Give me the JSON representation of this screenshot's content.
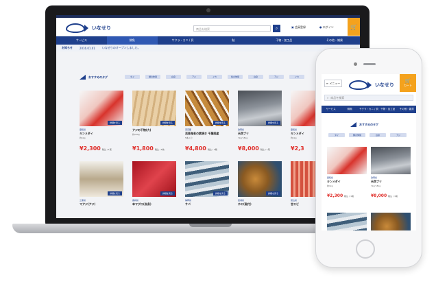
{
  "brand": {
    "logo_text": "いなせり"
  },
  "laptop": {
    "search_placeholder": "商品を検索",
    "links": [
      "会員登録",
      "ログイン"
    ],
    "cart_icon": "cart-icon",
    "nav": [
      "サービス",
      "鮮魚",
      "サクラ・カニ / 貝",
      "鮭",
      "干物・加工品",
      "その他・雑貨"
    ],
    "notice_label": "お知らせ",
    "notice_date": "2016.01.01",
    "notice_text": "いなせりのオープンしました。",
    "section_title": "おすすめのタグ",
    "tags": [
      "タイ",
      "鯛の仲間",
      "白身",
      "アジ",
      "イカ",
      "魚の仲間",
      "白身",
      "アジ",
      "イカ"
    ],
    "products": [
      {
        "area": "愛知県",
        "name": "キンメダイ",
        "sub": "約1kg",
        "price": "¥2,300",
        "unit": "税込 / 1尾",
        "badge": "詳細を見る"
      },
      {
        "area": "",
        "name": "アジの干物(大)",
        "sub": "約500g",
        "price": "¥1,800",
        "unit": "税込 / 1枚",
        "badge": "詳細を見る"
      },
      {
        "area": "東京都",
        "name": "活車海老の素焼き 千葉県産",
        "sub": "5本入り",
        "price": "¥4,800",
        "unit": "税込 / 1箱",
        "badge": "詳細を見る"
      },
      {
        "area": "静岡県",
        "name": "天然ブリ",
        "sub": "7kg〜8kg",
        "price": "¥8,000",
        "unit": "税込 / 1尾",
        "badge": "詳細を見る"
      },
      {
        "area": "愛知県",
        "name": "キンメダイ",
        "sub": "約1kg",
        "price": "¥2,3",
        "unit": "",
        "badge": "詳細を見る"
      },
      {
        "area": "三重県",
        "name": "マアジ(アジ)",
        "sub": "",
        "price": "",
        "unit": "",
        "badge": "詳細を見る"
      },
      {
        "area": "長崎県",
        "name": "本マグロ(赤身)",
        "sub": "",
        "price": "",
        "unit": "",
        "badge": "詳細を見る"
      },
      {
        "area": "静岡県",
        "name": "サバ",
        "sub": "",
        "price": "",
        "unit": "",
        "badge": "詳細を見る"
      },
      {
        "area": "宮城県",
        "name": "ホヤ(殻付)",
        "sub": "",
        "price": "",
        "unit": "",
        "badge": "詳細を見る"
      },
      {
        "area": "富山県",
        "name": "甘エビ",
        "sub": "",
        "price": "",
        "unit": "",
        "badge": "詳細を見る"
      }
    ]
  },
  "phone": {
    "menu_label": "メニュー",
    "cart_label": "カート",
    "search_placeholder": "商品を検索",
    "nav": [
      "サービス",
      "鮮魚",
      "サクラ・カニ / 貝",
      "干物・加工品",
      "その他・雑貨"
    ],
    "section_title": "おすすめのタグ",
    "tags": [
      "タイ",
      "鯛の仲間",
      "白身",
      "アジ"
    ],
    "products": [
      {
        "area": "愛知県",
        "name": "キンメダイ",
        "sub": "約1kg",
        "price": "¥2,300",
        "unit": "税込 / 1尾"
      },
      {
        "area": "静岡県",
        "name": "天然ブリ",
        "sub": "7kg〜8kg",
        "price": "¥8,000",
        "unit": "税込 / 1尾"
      },
      {
        "area": "",
        "name": "",
        "sub": "",
        "price": "",
        "unit": ""
      },
      {
        "area": "",
        "name": "",
        "sub": "",
        "price": "",
        "unit": ""
      }
    ]
  },
  "colors": {
    "navy": "#1e3f8c",
    "accent": "#f4a21d",
    "price": "#e0302c"
  }
}
